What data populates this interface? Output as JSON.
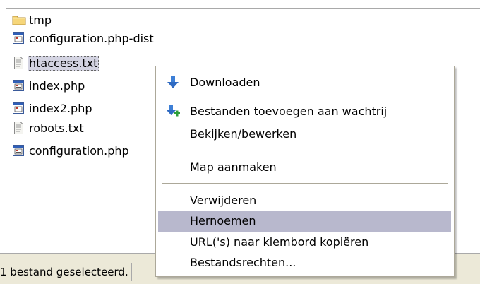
{
  "files": [
    {
      "name": "tmp",
      "icon": "folder-icon",
      "selected": false
    },
    {
      "name": "configuration.php-dist",
      "icon": "php-file-icon",
      "selected": false
    },
    {
      "name": "htaccess.txt",
      "icon": "text-file-icon",
      "selected": true
    },
    {
      "name": "index.php",
      "icon": "php-file-icon",
      "selected": false
    },
    {
      "name": "index2.php",
      "icon": "php-file-icon",
      "selected": false
    },
    {
      "name": "robots.txt",
      "icon": "text-file-icon",
      "selected": false
    },
    {
      "name": "configuration.php",
      "icon": "php-file-icon",
      "selected": false
    }
  ],
  "status": {
    "text": "1 bestand geselecteerd."
  },
  "menu": {
    "items": [
      {
        "label": "Downloaden",
        "icon": "download-arrow-icon"
      },
      {
        "label": "Bestanden toevoegen aan wachtrij",
        "icon": "add-to-queue-icon"
      },
      {
        "label": "Bekijken/bewerken",
        "icon": ""
      },
      {
        "label": "Map aanmaken",
        "icon": ""
      },
      {
        "label": "Verwijderen",
        "icon": ""
      },
      {
        "label": "Hernoemen",
        "icon": "",
        "highlighted": true
      },
      {
        "label": "URL('s) naar klembord kopiëren",
        "icon": ""
      },
      {
        "label": "Bestandsrechten...",
        "icon": ""
      }
    ]
  },
  "colors": {
    "menu_highlight": "#b8b8cd",
    "selection": "#d3d3e1",
    "status_bar": "#ece9d8",
    "border": "#a9a9a9"
  }
}
